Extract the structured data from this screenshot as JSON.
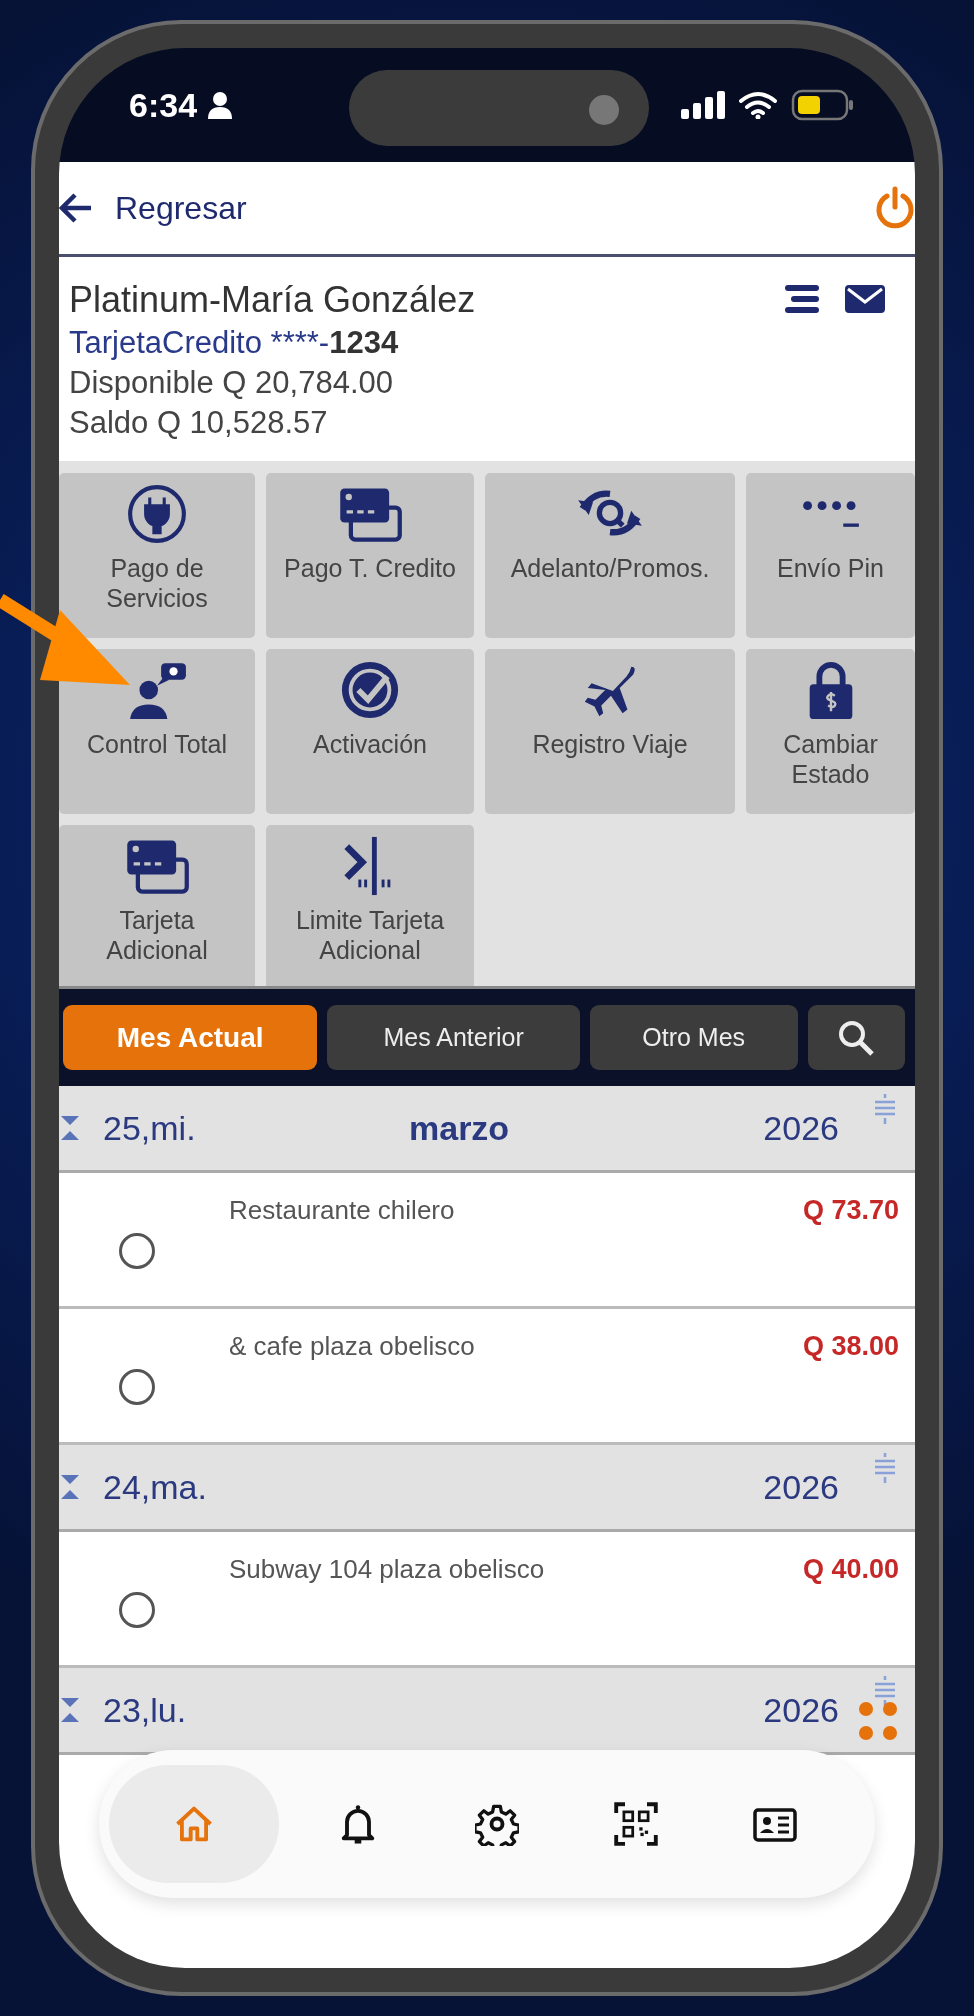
{
  "status_bar": {
    "time": "6:34"
  },
  "header": {
    "back_label": "Regresar"
  },
  "account": {
    "holder": "Platinum-María González",
    "card_type": "TarjetaCredito ****-",
    "card_number": "1234",
    "available": "Disponible Q 20,784.00",
    "balance": "Saldo Q 10,528.57"
  },
  "actions": [
    {
      "kind": "plug",
      "label": "Pago de Servicios"
    },
    {
      "kind": "cards",
      "label": "Pago T. Credito"
    },
    {
      "kind": "exchange",
      "label": "Adelanto/Promos."
    },
    {
      "kind": "pin",
      "label": "Envío Pin"
    },
    {
      "kind": "person",
      "label": "Control Total"
    },
    {
      "kind": "badge",
      "label": "Activación"
    },
    {
      "kind": "plane",
      "label": "Registro Viaje"
    },
    {
      "kind": "lock",
      "label": "Cambiar Estado"
    },
    {
      "kind": "cards",
      "label": "Tarjeta Adicional"
    },
    {
      "kind": "limit",
      "label": "Limite Tarjeta Adicional"
    }
  ],
  "period_tabs": [
    {
      "label": "Mes Actual",
      "selected": true
    },
    {
      "label": "Mes Anterior",
      "selected": false
    },
    {
      "label": "Otro Mes",
      "selected": false
    }
  ],
  "days": [
    {
      "day": "25,mi.",
      "month": "marzo",
      "year": "2026",
      "transactions": [
        {
          "description": "Restaurante chilero",
          "amount": "Q 73.70",
          "checked": false
        },
        {
          "description": "& cafe plaza obelisco",
          "amount": "Q 38.00",
          "checked": false
        }
      ]
    },
    {
      "day": "24,ma.",
      "year": "2026",
      "transactions": [
        {
          "description": "Subway 104 plaza obelisco",
          "amount": "Q 40.00",
          "checked": false
        }
      ]
    },
    {
      "day": "23,lu.",
      "year": "2026"
    }
  ],
  "bottom_nav": [
    {
      "kind": "home",
      "selected": true
    },
    {
      "kind": "bell",
      "selected": false
    },
    {
      "kind": "gear",
      "selected": false
    },
    {
      "kind": "qr",
      "selected": false
    },
    {
      "kind": "id",
      "selected": false
    }
  ]
}
